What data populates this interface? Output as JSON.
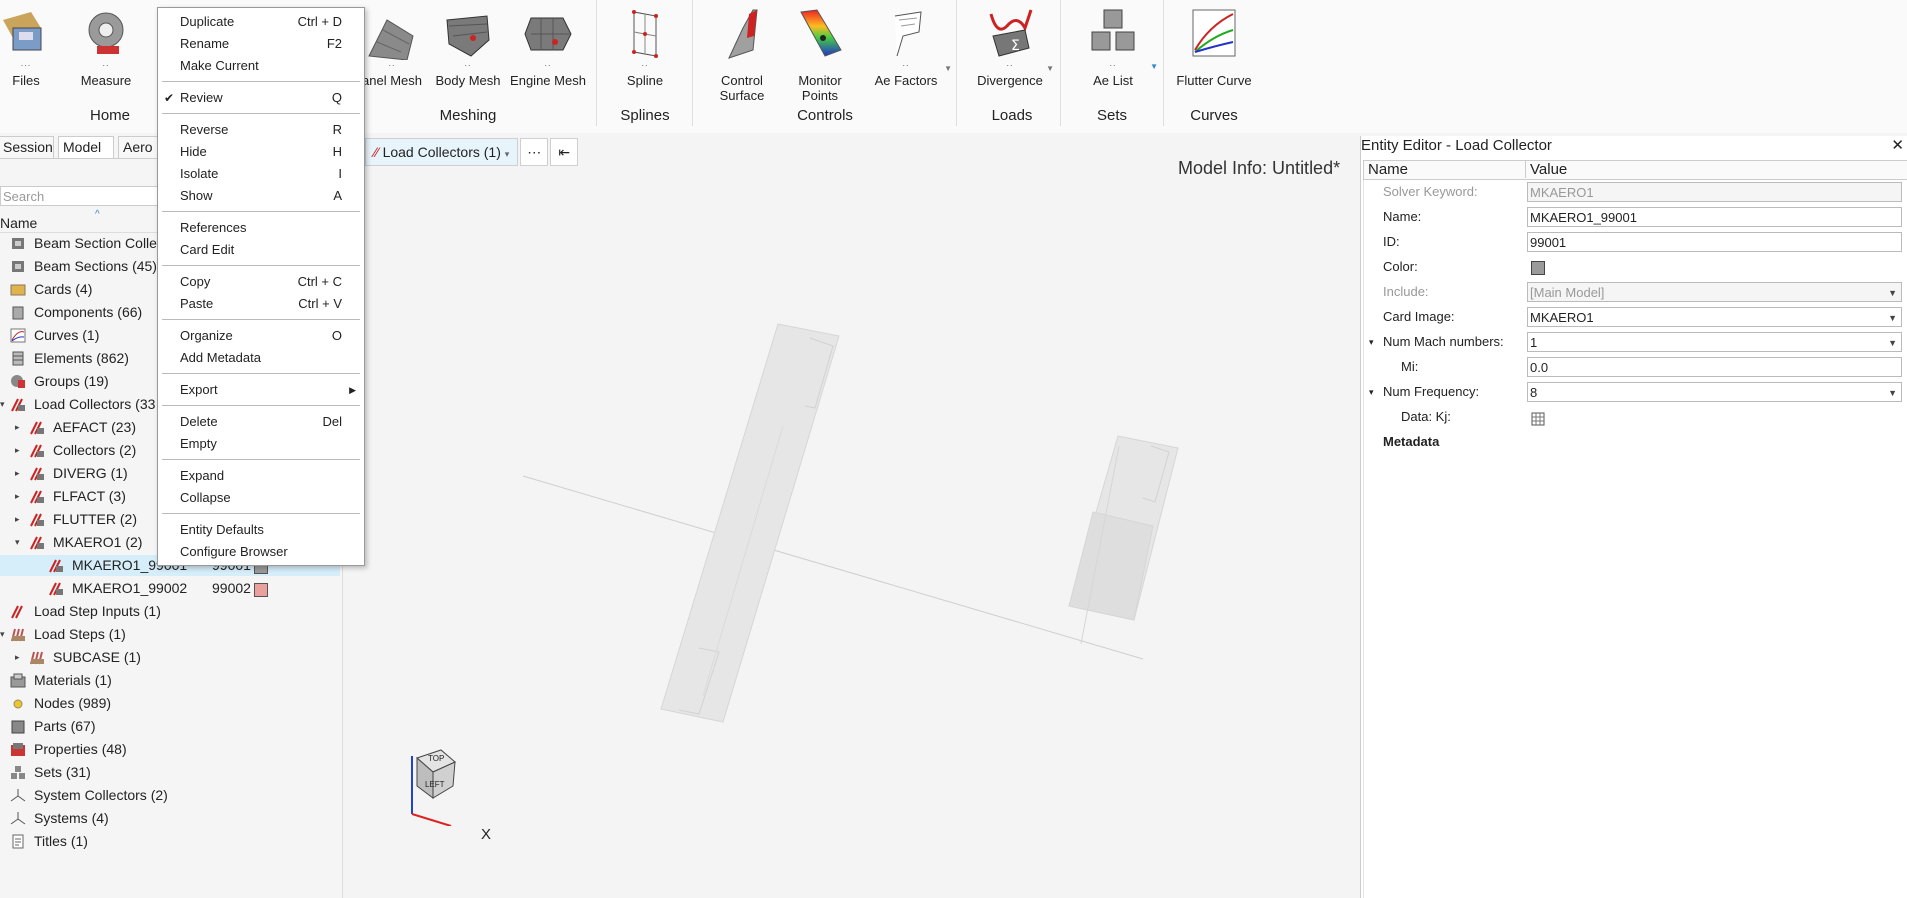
{
  "ribbon": {
    "buttons": [
      {
        "label": "Files",
        "icon": "files-icon"
      },
      {
        "label": "Measure",
        "icon": "measure-icon"
      },
      {
        "label": "anel Mesh",
        "icon": "panel-mesh-icon"
      },
      {
        "label": "Body Mesh",
        "icon": "body-mesh-icon"
      },
      {
        "label": "Engine Mesh",
        "icon": "engine-mesh-icon"
      },
      {
        "label": "Spline",
        "icon": "spline-icon"
      },
      {
        "label": "Control Surface",
        "icon": "control-surface-icon"
      },
      {
        "label": "Monitor Points",
        "icon": "monitor-points-icon"
      },
      {
        "label": "Ae Factors",
        "icon": "ae-factors-icon"
      },
      {
        "label": "Divergence",
        "icon": "divergence-icon"
      },
      {
        "label": "Ae List",
        "icon": "ae-list-icon"
      },
      {
        "label": "Flutter Curve",
        "icon": "flutter-curve-icon"
      }
    ],
    "groups": [
      "Home",
      "Meshing",
      "Splines",
      "Controls",
      "Loads",
      "Sets",
      "Curves"
    ]
  },
  "left_panel": {
    "tabs": [
      "Session",
      "Model",
      "Aero"
    ],
    "search_placeholder": "Search",
    "column_name": "Name",
    "tree": [
      {
        "label": "Beam Section Collec",
        "count": ""
      },
      {
        "label": "Beam Sections",
        "count": "(45)"
      },
      {
        "label": "Cards",
        "count": "(4)"
      },
      {
        "label": "Components",
        "count": "(66)"
      },
      {
        "label": "Curves",
        "count": "(1)"
      },
      {
        "label": "Elements",
        "count": "(862)"
      },
      {
        "label": "Groups",
        "count": "(19)"
      },
      {
        "label": "Load Collectors",
        "count": "(33"
      },
      {
        "label": "AEFACT",
        "count": "(23)"
      },
      {
        "label": "Collectors",
        "count": "(2)"
      },
      {
        "label": "DIVERG",
        "count": "(1)"
      },
      {
        "label": "FLFACT",
        "count": "(3)"
      },
      {
        "label": "FLUTTER",
        "count": "(2)"
      },
      {
        "label": "MKAERO1",
        "count": "(2)"
      },
      {
        "label": "MKAERO1_99001",
        "id": "99001",
        "swatch": "#9a9a9a"
      },
      {
        "label": "MKAERO1_99002",
        "id": "99002",
        "swatch": "#e8a29b"
      },
      {
        "label": "Load Step Inputs",
        "count": "(1)"
      },
      {
        "label": "Load Steps",
        "count": "(1)"
      },
      {
        "label": "SUBCASE",
        "count": "(1)"
      },
      {
        "label": "Materials",
        "count": "(1)"
      },
      {
        "label": "Nodes",
        "count": "(989)"
      },
      {
        "label": "Parts",
        "count": "(67)"
      },
      {
        "label": "Properties",
        "count": "(48)"
      },
      {
        "label": "Sets",
        "count": "(31)"
      },
      {
        "label": "System Collectors",
        "count": "(2)"
      },
      {
        "label": "Systems",
        "count": "(4)"
      },
      {
        "label": "Titles",
        "count": "(1)"
      }
    ]
  },
  "viewport": {
    "filter_button": "Load Collectors (1)",
    "more_button": "⋯",
    "collapse_button": "⇤",
    "model_info": "Model Info: Untitled*",
    "cube_top": "TOP",
    "cube_left": "LEFT",
    "axis_x": "X"
  },
  "entity_editor": {
    "title": "Entity Editor - Load Collector",
    "close": "✕",
    "col_name": "Name",
    "col_value": "Value",
    "rows": [
      {
        "name": "Solver Keyword:",
        "value": "MKAERO1"
      },
      {
        "name": "Name:",
        "value": "MKAERO1_99001"
      },
      {
        "name": "ID:",
        "value": "99001"
      },
      {
        "name": "Color:",
        "value": ""
      },
      {
        "name": "Include:",
        "value": "[Main Model]"
      },
      {
        "name": "Card Image:",
        "value": "MKAERO1"
      },
      {
        "name": "Num Mach numbers:",
        "value": "1"
      },
      {
        "name": "Mi:",
        "value": "0.0"
      },
      {
        "name": "Num Frequency:",
        "value": "8"
      },
      {
        "name": "Data: Kj:",
        "value": ""
      },
      {
        "name": "Metadata",
        "value": ""
      }
    ]
  },
  "context_menu": {
    "items": [
      {
        "label": "Duplicate",
        "shortcut": "Ctrl + D"
      },
      {
        "label": "Rename",
        "shortcut": "F2"
      },
      {
        "label": "Make Current",
        "shortcut": ""
      },
      {
        "label": "Review",
        "shortcut": "Q",
        "check": "✔"
      },
      {
        "label": "Reverse",
        "shortcut": "R"
      },
      {
        "label": "Hide",
        "shortcut": "H"
      },
      {
        "label": "Isolate",
        "shortcut": "I"
      },
      {
        "label": "Show",
        "shortcut": "A"
      },
      {
        "label": "References",
        "shortcut": ""
      },
      {
        "label": "Card Edit",
        "shortcut": ""
      },
      {
        "label": "Copy",
        "shortcut": "Ctrl + C"
      },
      {
        "label": "Paste",
        "shortcut": "Ctrl + V"
      },
      {
        "label": "Organize",
        "shortcut": "O"
      },
      {
        "label": "Add Metadata",
        "shortcut": ""
      },
      {
        "label": "Export",
        "shortcut": "▶"
      },
      {
        "label": "Delete",
        "shortcut": "Del"
      },
      {
        "label": "Empty",
        "shortcut": ""
      },
      {
        "label": "Expand",
        "shortcut": ""
      },
      {
        "label": "Collapse",
        "shortcut": ""
      },
      {
        "label": "Entity Defaults",
        "shortcut": ""
      },
      {
        "label": "Configure Browser",
        "shortcut": ""
      }
    ]
  },
  "colors": {
    "accent": "#d6eefa",
    "selected_swatch": "#9a9a9a",
    "second_swatch": "#e8a29b"
  }
}
